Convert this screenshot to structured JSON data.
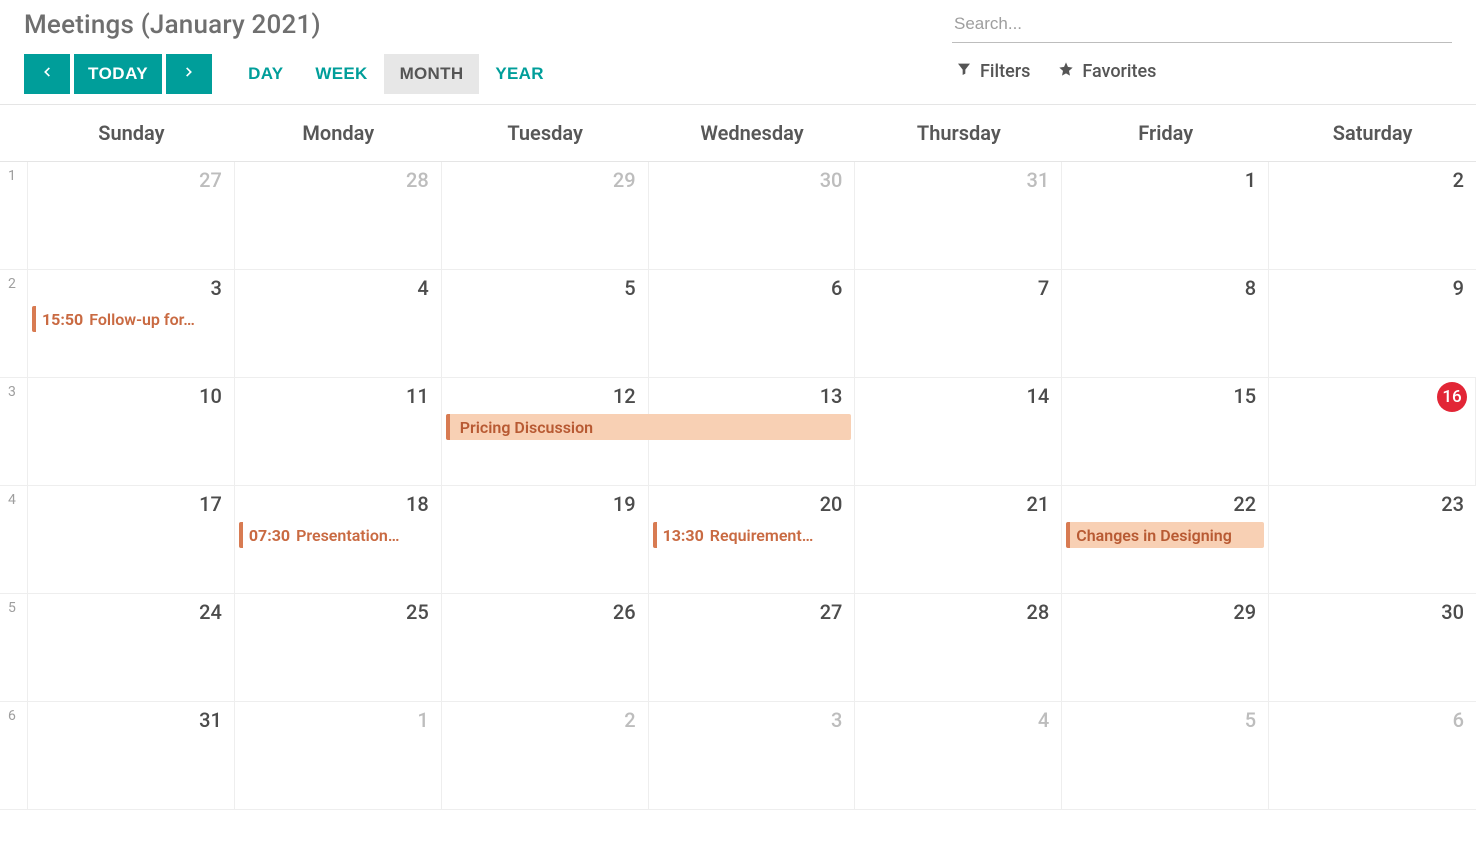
{
  "header": {
    "title": "Meetings (January 2021)",
    "today_label": "TODAY",
    "search_placeholder": "Search...",
    "filters_label": "Filters",
    "favorites_label": "Favorites"
  },
  "views": {
    "day": "DAY",
    "week": "WEEK",
    "month": "MONTH",
    "year": "YEAR",
    "active": "month"
  },
  "calendar": {
    "day_headers": [
      "Sunday",
      "Monday",
      "Tuesday",
      "Wednesday",
      "Thursday",
      "Friday",
      "Saturday"
    ],
    "weeks": [
      {
        "num": "1",
        "days": [
          {
            "d": "27",
            "out": true
          },
          {
            "d": "28",
            "out": true
          },
          {
            "d": "29",
            "out": true
          },
          {
            "d": "30",
            "out": true
          },
          {
            "d": "31",
            "out": true
          },
          {
            "d": "1"
          },
          {
            "d": "2"
          }
        ]
      },
      {
        "num": "2",
        "days": [
          {
            "d": "3",
            "events": [
              {
                "time": "15:50",
                "title": "Follow-up for…",
                "allday": false
              }
            ]
          },
          {
            "d": "4"
          },
          {
            "d": "5"
          },
          {
            "d": "6"
          },
          {
            "d": "7"
          },
          {
            "d": "8"
          },
          {
            "d": "9"
          }
        ]
      },
      {
        "num": "3",
        "days": [
          {
            "d": "10"
          },
          {
            "d": "11"
          },
          {
            "d": "12"
          },
          {
            "d": "13"
          },
          {
            "d": "14"
          },
          {
            "d": "15"
          },
          {
            "d": "16",
            "today": true
          }
        ],
        "spans": [
          {
            "startCol": 2,
            "endCol": 3,
            "title": "Pricing Discussion"
          }
        ]
      },
      {
        "num": "4",
        "days": [
          {
            "d": "17"
          },
          {
            "d": "18",
            "events": [
              {
                "time": "07:30",
                "title": "Presentation…",
                "allday": false
              }
            ]
          },
          {
            "d": "19"
          },
          {
            "d": "20",
            "events": [
              {
                "time": "13:30",
                "title": "Requirement…",
                "allday": false
              }
            ]
          },
          {
            "d": "21"
          },
          {
            "d": "22",
            "events": [
              {
                "title": "Changes in Designing",
                "allday": true
              }
            ]
          },
          {
            "d": "23"
          }
        ]
      },
      {
        "num": "5",
        "days": [
          {
            "d": "24"
          },
          {
            "d": "25"
          },
          {
            "d": "26"
          },
          {
            "d": "27"
          },
          {
            "d": "28"
          },
          {
            "d": "29"
          },
          {
            "d": "30"
          }
        ]
      },
      {
        "num": "6",
        "days": [
          {
            "d": "31"
          },
          {
            "d": "1",
            "out": true
          },
          {
            "d": "2",
            "out": true
          },
          {
            "d": "3",
            "out": true
          },
          {
            "d": "4",
            "out": true
          },
          {
            "d": "5",
            "out": true
          },
          {
            "d": "6",
            "out": true
          }
        ]
      }
    ]
  }
}
